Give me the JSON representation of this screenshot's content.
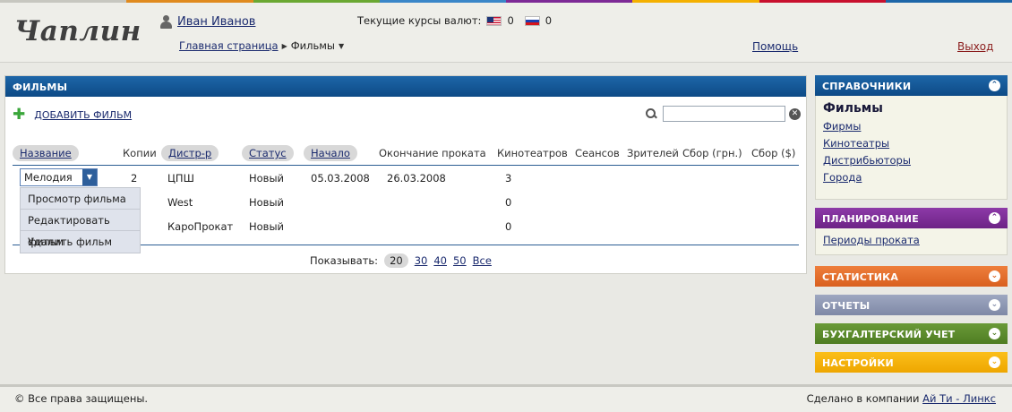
{
  "colors": {
    "accent_blue": "#0d4a86",
    "planning": "#7d2a96",
    "stats": "#e06a2c",
    "reports": "#8d97b3",
    "accounting": "#5a8a2a",
    "settings": "#f4b000"
  },
  "topbar_colors": [
    "#c7c7c0",
    "#e08a1e",
    "#6aa832",
    "#3a86c8",
    "#7d2a96",
    "#f4b000",
    "#c8102e",
    "#1d66a8"
  ],
  "header": {
    "logo": "Чаплин",
    "user_name": "Иван Иванов",
    "breadcrumb": {
      "home": "Главная страница",
      "current": "Фильмы"
    },
    "currency_label": "Текущие курсы валют:",
    "usd_rate": "0",
    "rub_rate": "0",
    "help": "Помощь",
    "logout": "Выход"
  },
  "main": {
    "title": "ФИЛЬМЫ",
    "add_film": "ДОБАВИТЬ ФИЛЬМ",
    "search_placeholder": "",
    "columns": {
      "name": "Название",
      "copies": "Копии",
      "distributor": "Дистр-р",
      "status": "Статус",
      "start": "Начало",
      "end": "Окончание проката",
      "cinemas": "Кинотеатров",
      "sessions": "Сеансов",
      "viewers": "Зрителей",
      "gross_uah": "Сбор (грн.)",
      "gross_usd": "Сбор ($)"
    },
    "rows": [
      {
        "name": "Мелодия",
        "copies": "2",
        "distributor": "ЦПШ",
        "status": "Новый",
        "start": "05.03.2008",
        "end": "26.03.2008",
        "cinemas": "3"
      },
      {
        "distributor": "West",
        "status": "Новый",
        "cinemas": "0"
      },
      {
        "distributor": "КароПрокат",
        "status": "Новый",
        "cinemas": "0"
      }
    ],
    "context_menu": [
      "Просмотр фильма",
      "Редактировать фильм",
      "Удалить фильм"
    ],
    "pager": {
      "label": "Показывать:",
      "options": [
        "20",
        "30",
        "40",
        "50",
        "Все"
      ]
    }
  },
  "sidebar": {
    "reference": {
      "title": "СПРАВОЧНИКИ",
      "current": "Фильмы",
      "links": [
        "Фирмы",
        "Кинотеатры",
        "Дистрибьюторы",
        "Города"
      ]
    },
    "planning": {
      "title": "ПЛАНИРОВАНИЕ",
      "links": [
        "Периоды проката"
      ]
    },
    "statistics": "СТАТИСТИКА",
    "reports": "ОТЧЕТЫ",
    "accounting": "БУХГАЛТЕРСКИЙ УЧЕТ",
    "settings": "НАСТРОЙКИ"
  },
  "footer": {
    "copyright": "© Все права защищены.",
    "made_by": "Сделано в компании",
    "company": "Ай Ти - Линкс"
  }
}
